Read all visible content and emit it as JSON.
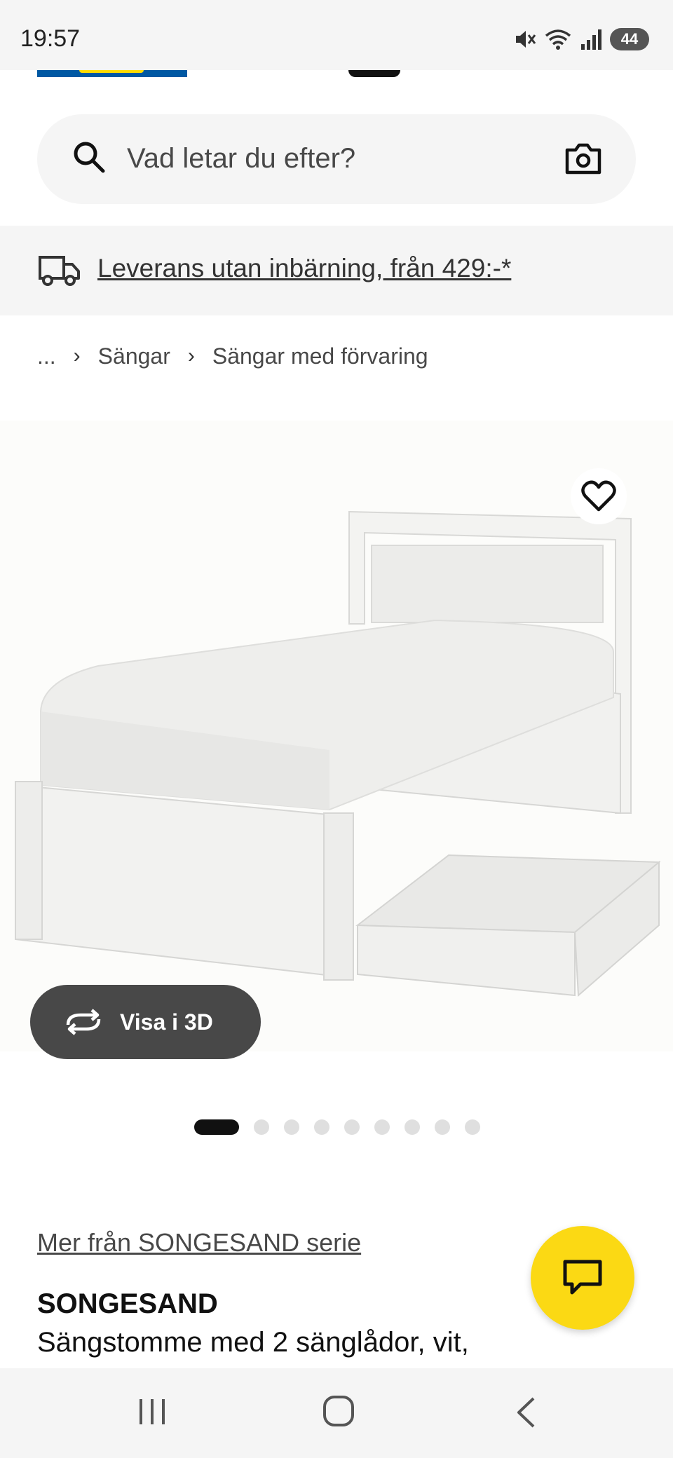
{
  "status_bar": {
    "time": "19:57",
    "battery": "44",
    "icons": [
      "mute-icon",
      "wifi-icon",
      "signal-icon",
      "battery-icon"
    ]
  },
  "search": {
    "placeholder": "Vad letar du efter?"
  },
  "delivery_banner": {
    "text": "Leverans utan inbärning, från 429:-*"
  },
  "breadcrumb": {
    "items": [
      "...",
      "Sängar",
      "Sängar med förvaring"
    ]
  },
  "gallery": {
    "view_3d_label": "Visa i 3D",
    "image_count": 9,
    "active_index": 0
  },
  "product": {
    "series_link": "Mer från SONGESAND serie",
    "name": "SONGESAND",
    "description": "Sängstomme med 2 sänglådor, vit,"
  },
  "colors": {
    "ikea_blue": "#0058a3",
    "ikea_yellow": "#fbd914",
    "banner_bg": "#f5f5f5"
  }
}
